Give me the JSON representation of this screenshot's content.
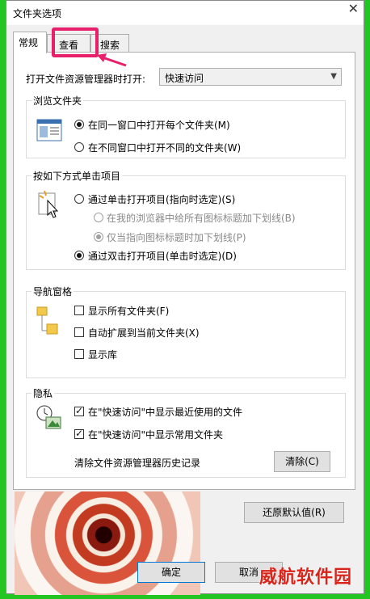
{
  "window": {
    "title": "文件夹选项",
    "close_glyph": "✕"
  },
  "tabs": [
    {
      "label": "常规"
    },
    {
      "label": "查看"
    },
    {
      "label": "搜索"
    }
  ],
  "open_explorer": {
    "label": "打开文件资源管理器时打开:",
    "value": "快速访问"
  },
  "browse_folders": {
    "title": "浏览文件夹",
    "options": [
      {
        "label": "在同一窗口中打开每个文件夹(M)",
        "checked": true
      },
      {
        "label": "在不同窗口中打开不同的文件夹(W)",
        "checked": false
      }
    ]
  },
  "click_items": {
    "title": "按如下方式单击项目",
    "options": [
      {
        "label": "通过单击打开项目(指向时选定)(S)",
        "checked": false
      },
      {
        "label": "在我的浏览器中给所有图标标题加下划线(B)",
        "checked": false,
        "disabled": true
      },
      {
        "label": "仅当指向图标标题时加下划线(P)",
        "checked": true,
        "disabled": true
      },
      {
        "label": "通过双击打开项目(单击时选定)(D)",
        "checked": true
      }
    ]
  },
  "nav_pane": {
    "title": "导航窗格",
    "options": [
      {
        "label": "显示所有文件夹(F)",
        "checked": false
      },
      {
        "label": "自动扩展到当前文件夹(X)",
        "checked": false
      },
      {
        "label": "显示库",
        "checked": false
      }
    ]
  },
  "privacy": {
    "title": "隐私",
    "options": [
      {
        "label": "在\"快速访问\"中显示最近使用的文件",
        "checked": true
      },
      {
        "label": "在\"快速访问\"中显示常用文件夹",
        "checked": true
      }
    ],
    "clear_label": "清除文件资源管理器历史记录",
    "clear_button": "清除(C)"
  },
  "restore_button": "还原默认值(R)",
  "footer": {
    "ok": "确定",
    "cancel": "取消"
  },
  "watermark": "威航软件园",
  "colors": {
    "frame": "#22c522",
    "highlight": "#e8206b",
    "watermark": "#d9241b"
  }
}
